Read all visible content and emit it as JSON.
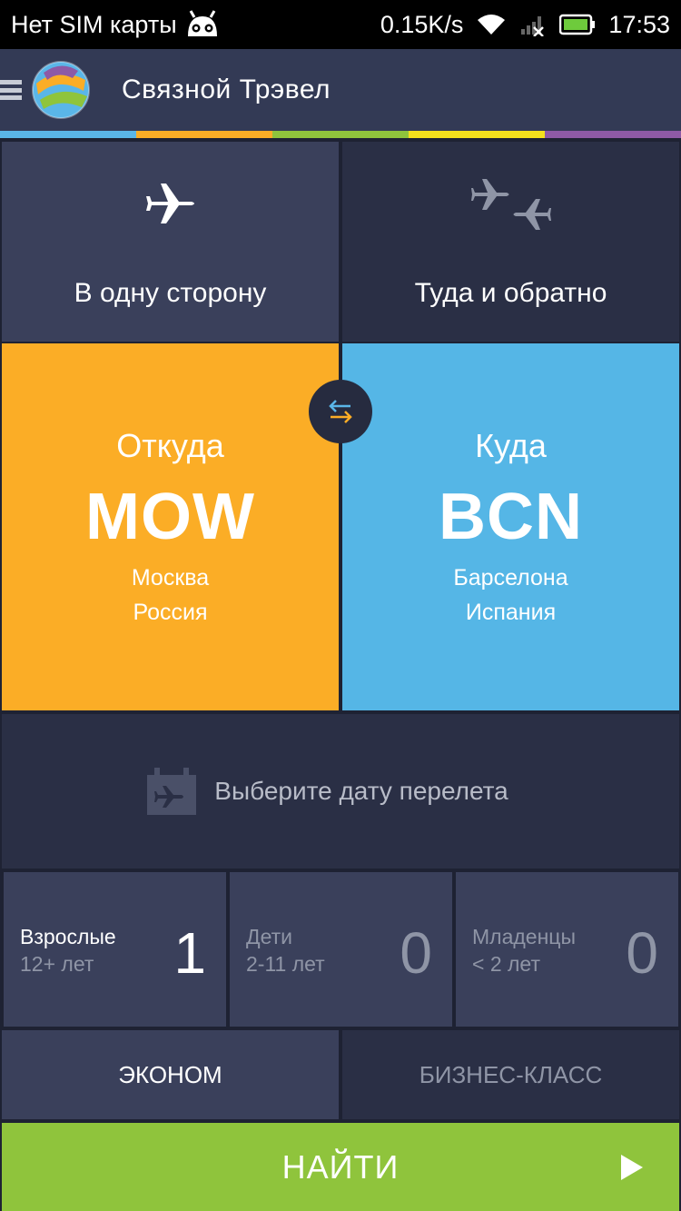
{
  "status_bar": {
    "carrier": "Нет SIM карты",
    "speed": "0.15K/s",
    "time": "17:53"
  },
  "app_bar": {
    "title": "Связной Трэвел"
  },
  "accent_strip": [
    "#5ab6e8",
    "#fbad26",
    "#8fc43c",
    "#f4e01c",
    "#8e5aa6"
  ],
  "trip_type": {
    "one_way": "В одну сторону",
    "round_trip": "Туда и обратно",
    "selected": "one_way"
  },
  "route": {
    "from": {
      "caption": "Откуда",
      "code": "MOW",
      "city": "Москва",
      "country": "Россия"
    },
    "to": {
      "caption": "Куда",
      "code": "BCN",
      "city": "Барселона",
      "country": "Испания"
    }
  },
  "date": {
    "placeholder": "Выберите дату перелета"
  },
  "passengers": [
    {
      "name": "Взрослые",
      "age": "12+ лет",
      "count": "1"
    },
    {
      "name": "Дети",
      "age": "2-11 лет",
      "count": "0"
    },
    {
      "name": "Младенцы",
      "age": "< 2 лет",
      "count": "0"
    }
  ],
  "cabin_class": {
    "economy": "ЭКОНОМ",
    "business": "БИЗНЕС-КЛАСС",
    "selected": "economy"
  },
  "search": {
    "label": "НАЙТИ"
  },
  "colors": {
    "origin": "#fbad26",
    "destination": "#55b6e6",
    "search": "#8fc43c"
  },
  "icons": [
    "android-icon",
    "wifi-icon",
    "signal-icon",
    "battery-icon",
    "menu-icon",
    "app-logo",
    "plane-icon",
    "round-trip-planes-icon",
    "swap-icon",
    "calendar-plane-icon",
    "play-icon"
  ]
}
